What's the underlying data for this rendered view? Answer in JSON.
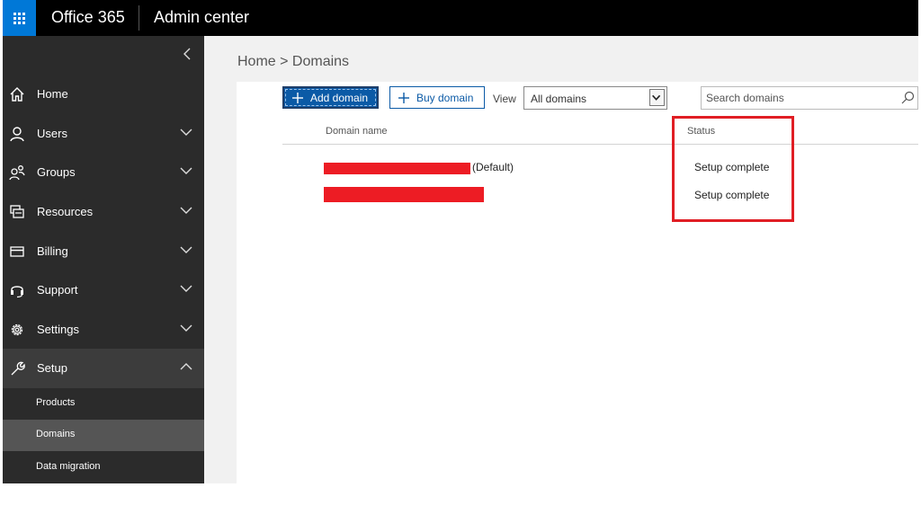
{
  "topbar": {
    "app_name": "Office 365",
    "section_name": "Admin center",
    "waffle_icon": "app-launcher-icon"
  },
  "sidebar": {
    "collapse_icon": "chevron-left-icon",
    "items": [
      {
        "label": "Home",
        "icon": "home-icon",
        "expandable": false
      },
      {
        "label": "Users",
        "icon": "user-icon",
        "expandable": true
      },
      {
        "label": "Groups",
        "icon": "groups-icon",
        "expandable": true
      },
      {
        "label": "Resources",
        "icon": "resources-icon",
        "expandable": true
      },
      {
        "label": "Billing",
        "icon": "billing-icon",
        "expandable": true
      },
      {
        "label": "Support",
        "icon": "headset-icon",
        "expandable": true
      },
      {
        "label": "Settings",
        "icon": "gear-icon",
        "expandable": true
      },
      {
        "label": "Setup",
        "icon": "wrench-icon",
        "expandable": true,
        "expanded": true
      }
    ],
    "subitems": [
      {
        "label": "Products"
      },
      {
        "label": "Domains",
        "current": true
      },
      {
        "label": "Data migration"
      }
    ]
  },
  "main": {
    "breadcrumb": "Home > Domains",
    "toolbar": {
      "add_domain_label": "Add domain",
      "buy_domain_label": "Buy domain",
      "view_label": "View",
      "view_selected": "All domains",
      "search_placeholder": "Search domains"
    },
    "table": {
      "columns": [
        "Domain name",
        "Status"
      ],
      "rows": [
        {
          "domain": "[redacted]",
          "suffix": "(Default)",
          "status": "Setup complete"
        },
        {
          "domain": "[redacted]",
          "suffix": "",
          "status": "Setup complete"
        }
      ]
    }
  },
  "colors": {
    "topbar": "#000000",
    "waffle": "#0078d7",
    "sidebar": "#2b2b2b",
    "primary_button": "#0b5aa6",
    "redaction": "#ed1c24",
    "highlight_box": "#e01e24"
  }
}
